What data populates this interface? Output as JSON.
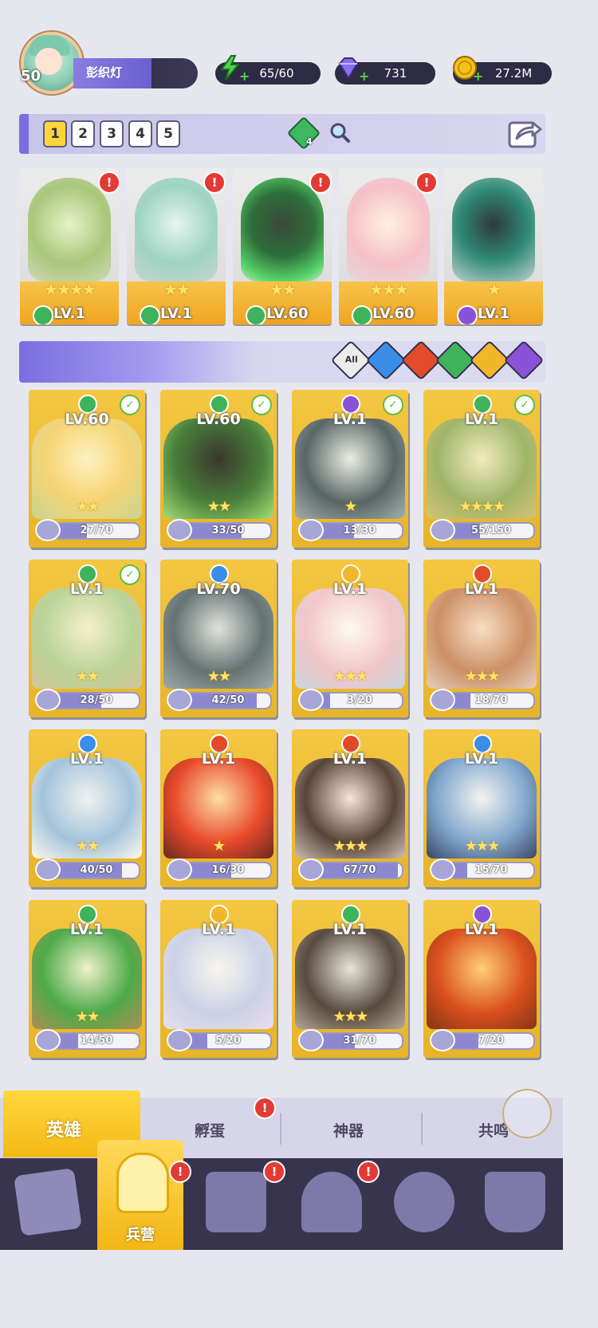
{
  "player": {
    "level": "50",
    "name": "彭织灯"
  },
  "resources": {
    "energy": {
      "value": "65/60",
      "icon": "lightning-icon",
      "color": "#4fd44c"
    },
    "gems": {
      "value": "731",
      "icon": "gem-icon",
      "color": "#8b6ef0"
    },
    "gold": {
      "value": "27.2M",
      "icon": "coin-icon",
      "color": "#f3c21a"
    }
  },
  "team": {
    "slots": [
      "1",
      "2",
      "3",
      "4",
      "5"
    ],
    "active_slot": "1",
    "gem_count": "4"
  },
  "team_cards": [
    {
      "level": "LV.1",
      "stars": "★★★★",
      "element": "nature",
      "alert": "!"
    },
    {
      "level": "LV.1",
      "stars": "★★",
      "element": "nature",
      "alert": "!"
    },
    {
      "level": "LV.60",
      "stars": "★★",
      "element": "nature",
      "alert": "!"
    },
    {
      "level": "LV.60",
      "stars": "★★★",
      "element": "nature",
      "alert": "!"
    },
    {
      "level": "LV.1",
      "stars": "★",
      "element": "dark",
      "alert": ""
    }
  ],
  "filters": {
    "all_label": "All",
    "elements": [
      "water",
      "fire",
      "nature",
      "light",
      "dark"
    ]
  },
  "heroes": [
    {
      "level": "LV.60",
      "element": "nature",
      "stars": "★★",
      "progress": "27/70",
      "checked": true
    },
    {
      "level": "LV.60",
      "element": "nature",
      "stars": "★★",
      "progress": "33/50",
      "checked": true
    },
    {
      "level": "LV.1",
      "element": "dark",
      "stars": "★",
      "progress": "13/30",
      "checked": true
    },
    {
      "level": "LV.1",
      "element": "nature",
      "stars": "★★★★",
      "progress": "55/150",
      "checked": true
    },
    {
      "level": "LV.1",
      "element": "nature",
      "stars": "★★",
      "progress": "28/50",
      "checked": true
    },
    {
      "level": "LV.70",
      "element": "water",
      "stars": "★★",
      "progress": "42/50",
      "checked": false
    },
    {
      "level": "LV.1",
      "element": "light",
      "stars": "★★★",
      "progress": "3/20",
      "checked": false
    },
    {
      "level": "LV.1",
      "element": "fire",
      "stars": "★★★",
      "progress": "18/70",
      "checked": false
    },
    {
      "level": "LV.1",
      "element": "water",
      "stars": "★★",
      "progress": "40/50",
      "checked": false
    },
    {
      "level": "LV.1",
      "element": "fire",
      "stars": "★",
      "progress": "16/30",
      "checked": false
    },
    {
      "level": "LV.1",
      "element": "fire",
      "stars": "★★★",
      "progress": "67/70",
      "checked": false
    },
    {
      "level": "LV.1",
      "element": "water",
      "stars": "★★★",
      "progress": "15/70",
      "checked": false
    },
    {
      "level": "LV.1",
      "element": "nature",
      "stars": "★★",
      "progress": "14/50",
      "checked": false
    },
    {
      "level": "LV.1",
      "element": "light",
      "stars": "",
      "progress": "5/20",
      "checked": false
    },
    {
      "level": "LV.1",
      "element": "nature",
      "stars": "★★★",
      "progress": "31/70",
      "checked": false
    },
    {
      "level": "LV.1",
      "element": "dark",
      "stars": "",
      "progress": "7/20",
      "checked": false
    }
  ],
  "tabs": [
    {
      "label": "英雄",
      "active": true
    },
    {
      "label": "孵蛋",
      "alert": true
    },
    {
      "label": "神器"
    },
    {
      "label": "共鸣"
    }
  ],
  "nav": {
    "active_label": "兵营"
  },
  "colors": {
    "nature": "#3fb35a",
    "water": "#3a8ee8",
    "fire": "#e24a2a",
    "light": "#f1b62a",
    "dark": "#8a52d6",
    "accent": "#ffd43b"
  }
}
